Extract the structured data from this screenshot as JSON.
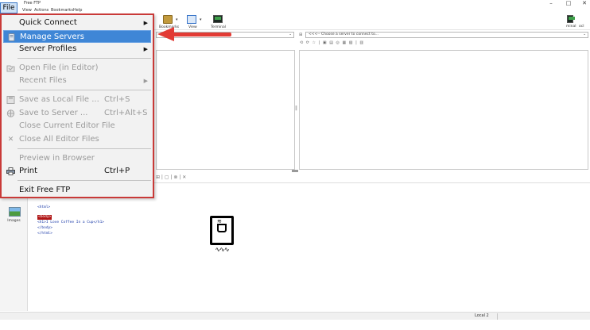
{
  "window": {
    "title": "Free FTP",
    "controls": [
      "–",
      "□",
      "✕"
    ]
  },
  "menubar": {
    "file": "File",
    "items": [
      "View",
      "Actions",
      "Bookmarks",
      "Help"
    ]
  },
  "toolbar": {
    "bookmarks": "Bookmarks",
    "view": "View",
    "terminal": "Terminal",
    "right_label_1": "minal",
    "right_label_2": "ocl"
  },
  "remote_addr": {
    "placeholder": "<<<-- Choose a server to connect to..."
  },
  "file_menu": {
    "quick_connect": "Quick Connect",
    "manage_servers": "Manage Servers",
    "server_profiles": "Server Profiles",
    "open_file": "Open File (in Editor)",
    "recent_files": "Recent Files",
    "save_as_local": "Save as Local File ...",
    "save_as_local_shortcut": "Ctrl+S",
    "save_to_server": "Save to Server ...",
    "save_to_server_shortcut": "Ctrl+Alt+S",
    "close_current": "Close Current Editor File",
    "close_all": "Close All Editor Files",
    "preview": "Preview in Browser",
    "print": "Print",
    "print_shortcut": "Ctrl+P",
    "exit": "Exit Free FTP"
  },
  "sidebar": {
    "images_label": "Images"
  },
  "editor": {
    "line1": "<html>",
    "line2": "<body>",
    "line3": "<h1>I Love Coffee In a Cup</h1>",
    "line4": "</body>",
    "line5": "</html>"
  },
  "status": {
    "text": "Local 2"
  },
  "colors": {
    "highlight": "#3f86d6",
    "menu_border": "#c93a38",
    "arrow": "#e23b35"
  }
}
